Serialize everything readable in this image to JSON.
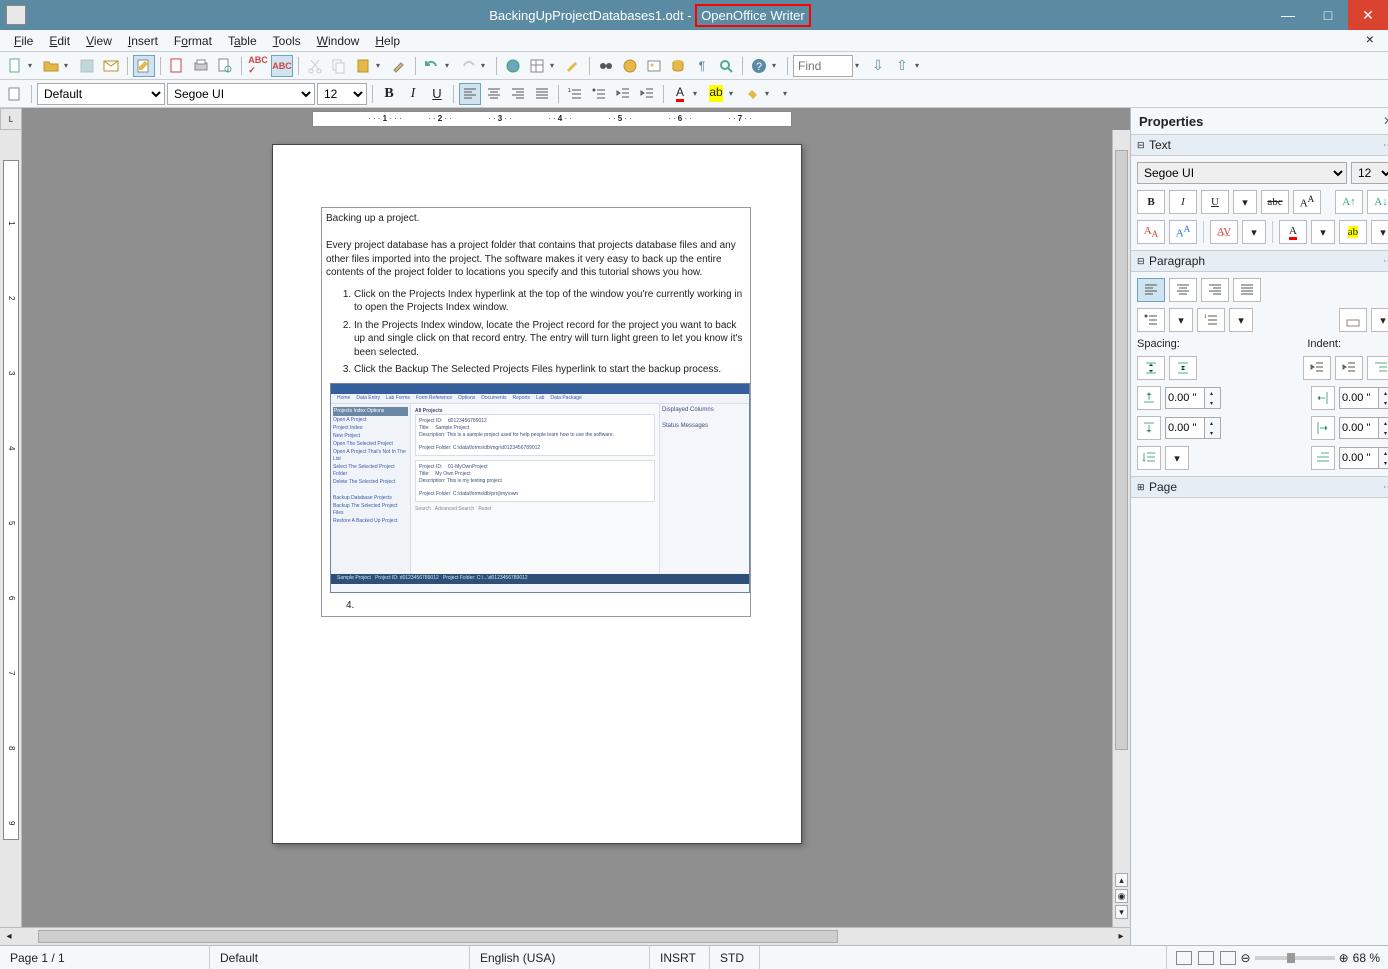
{
  "window": {
    "doc_name": "BackingUpProjectDatabases1.odt",
    "app_name": "OpenOffice Writer",
    "separator": " - "
  },
  "menubar": {
    "file": "File",
    "edit": "Edit",
    "view": "View",
    "insert": "Insert",
    "format": "Format",
    "table": "Table",
    "tools": "Tools",
    "window": "Window",
    "help": "Help"
  },
  "toolbar2": {
    "style": "Default",
    "font": "Segoe UI",
    "size": "12"
  },
  "find": {
    "placeholder": "Find"
  },
  "document": {
    "title": "Backing up a project.",
    "intro": "Every project database has a project folder that contains that projects database files and any other files imported into the project. The software makes it very easy to back up the entire contents of the project folder to locations you specify and this tutorial shows you how.",
    "steps": [
      "Click on the Projects Index hyperlink at the top of the window you're currently working in to open the Projects Index window.",
      "In the Projects Index window, locate the Project record for the project you want to back up and single click on that record entry. The entry will turn light green to let you know it's been selected.",
      "Click the Backup The Selected Projects Files hyperlink to start the backup process."
    ],
    "step4": "4."
  },
  "properties": {
    "title": "Properties",
    "text": {
      "label": "Text",
      "font": "Segoe UI",
      "size": "12",
      "bold": "B",
      "italic": "I",
      "underline": "U",
      "strike": "abc",
      "super": "Aᴬ"
    },
    "paragraph": {
      "label": "Paragraph",
      "spacing_label": "Spacing:",
      "indent_label": "Indent:",
      "above": "0.00 \"",
      "below": "0.00 \"",
      "left": "0.00 \"",
      "right": "0.00 \"",
      "firstline": "0.00 \""
    },
    "page": {
      "label": "Page"
    }
  },
  "statusbar": {
    "page": "Page 1 / 1",
    "style": "Default",
    "lang": "English (USA)",
    "insert": "INSRT",
    "std": "STD",
    "zoom": "68 %"
  },
  "ruler": {
    "marks": [
      "1",
      "2",
      "3",
      "4",
      "5",
      "6",
      "7"
    ]
  }
}
